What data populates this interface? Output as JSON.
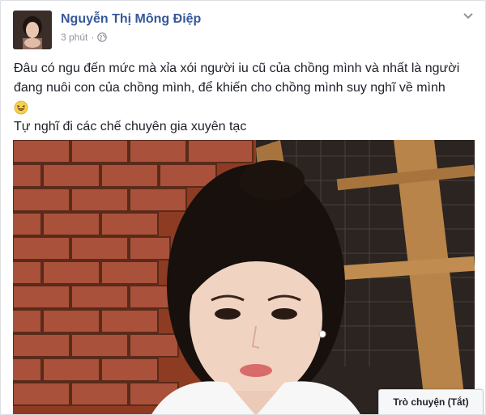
{
  "post": {
    "author_name": "Nguyễn Thị Mông Điệp",
    "timestamp": "3 phút",
    "separator": "·",
    "text_line1": "Đâu có ngu đến mức mà xỉa xói người iu cũ của chồng mình và nhất là người đang nuôi con của chồng mình, để khiến cho chồng mình suy nghĩ về mình",
    "text_line2": "Tự nghĩ đi các chế chuyên gia xuyên tạc"
  },
  "chat_tab": {
    "label": "Trò chuyện (Tắt)"
  },
  "colors": {
    "author": "#365899",
    "meta": "#90949c",
    "text": "#1d2129"
  },
  "icons": {
    "privacy": "globe-icon",
    "options": "chevron-down-icon",
    "emoji": "laughing-emoji-icon"
  }
}
